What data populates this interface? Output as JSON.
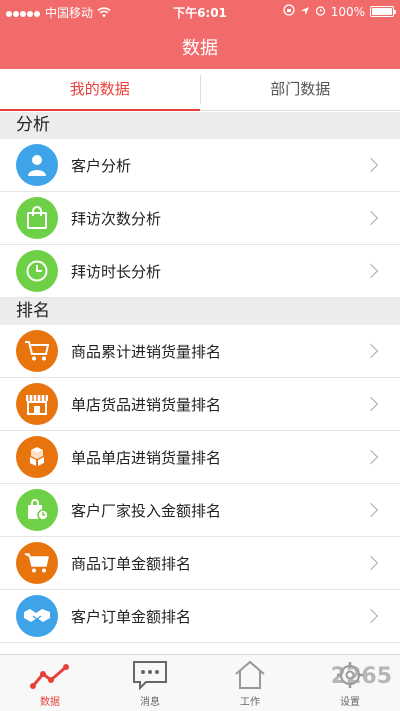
{
  "status_bar": {
    "carrier": "中国移动",
    "time": "下午6:01",
    "battery": "100%"
  },
  "header": {
    "title": "数据"
  },
  "tabs": [
    {
      "label": "我的数据",
      "active": true
    },
    {
      "label": "部门数据",
      "active": false
    }
  ],
  "sections": [
    {
      "title": "分析",
      "items": [
        {
          "label": "客户分析",
          "icon": "person-icon",
          "color": "#3fa3e8"
        },
        {
          "label": "拜访次数分析",
          "icon": "shopping-bag-icon",
          "color": "#6ed046"
        },
        {
          "label": "拜访时长分析",
          "icon": "clock-icon",
          "color": "#6ed046"
        }
      ]
    },
    {
      "title": "排名",
      "items": [
        {
          "label": "商品累计进销货量排名",
          "icon": "cart-icon",
          "color": "#e8740d"
        },
        {
          "label": "单店货品进销货量排名",
          "icon": "store-icon",
          "color": "#e8740d"
        },
        {
          "label": "单品单店进销货量排名",
          "icon": "boxes-icon",
          "color": "#e8740d"
        },
        {
          "label": "客户厂家投入金额排名",
          "icon": "bag-clock-icon",
          "color": "#6ed046"
        },
        {
          "label": "商品订单金额排名",
          "icon": "cart-icon",
          "color": "#e8740d"
        },
        {
          "label": "客户订单金额排名",
          "icon": "handshake-icon",
          "color": "#3fa3e8"
        }
      ]
    }
  ],
  "tabbar": [
    {
      "label": "数据",
      "icon": "chart-line-icon",
      "active": true
    },
    {
      "label": "消息",
      "icon": "message-icon",
      "active": false
    },
    {
      "label": "工作",
      "icon": "home-icon",
      "active": false
    },
    {
      "label": "设置",
      "icon": "gear-icon",
      "active": false
    }
  ],
  "watermark": "2265"
}
